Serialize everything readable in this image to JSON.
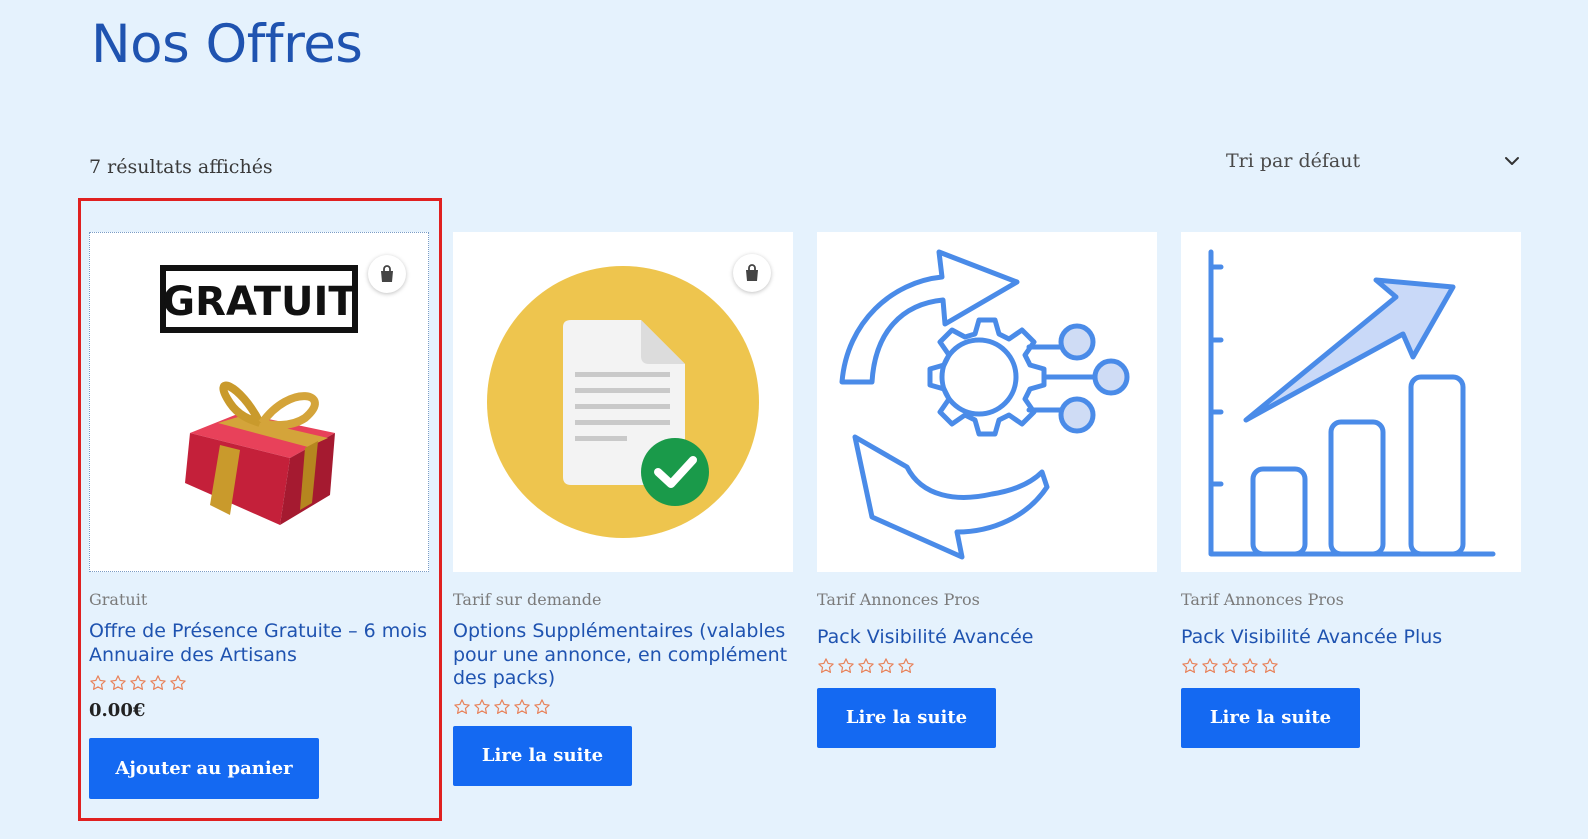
{
  "page": {
    "title": "Nos Offres"
  },
  "toolbar": {
    "results_text": "7 résultats affichés",
    "sort_label": "Tri par défaut"
  },
  "products": [
    {
      "category": "Gratuit",
      "name": "Offre de Présence Gratuite – 6 mois Annuaire des Artisans",
      "price": "0.00€",
      "button_label": "Ajouter au panier",
      "badge_text": "GRATUIT",
      "rating": 0
    },
    {
      "category": "Tarif sur demande",
      "name": "Options Supplémentaires (valables pour une annonce, en complément des packs)",
      "button_label": "Lire la suite",
      "rating": 0
    },
    {
      "category": "Tarif Annonces Pros",
      "name": "Pack Visibilité Avancée",
      "button_label": "Lire la suite",
      "rating": 0
    },
    {
      "category": "Tarif Annonces Pros",
      "name": "Pack Visibilité Avancée Plus",
      "button_label": "Lire la suite",
      "rating": 0
    }
  ],
  "colors": {
    "background": "#e5f2fd",
    "title": "#1f53b0",
    "button": "#1469f2",
    "star": "#e8825a",
    "highlight": "#e02020",
    "icon_blue": "#4a8be8",
    "doc_circle": "#eec54e",
    "check_green": "#1a9a4a"
  }
}
